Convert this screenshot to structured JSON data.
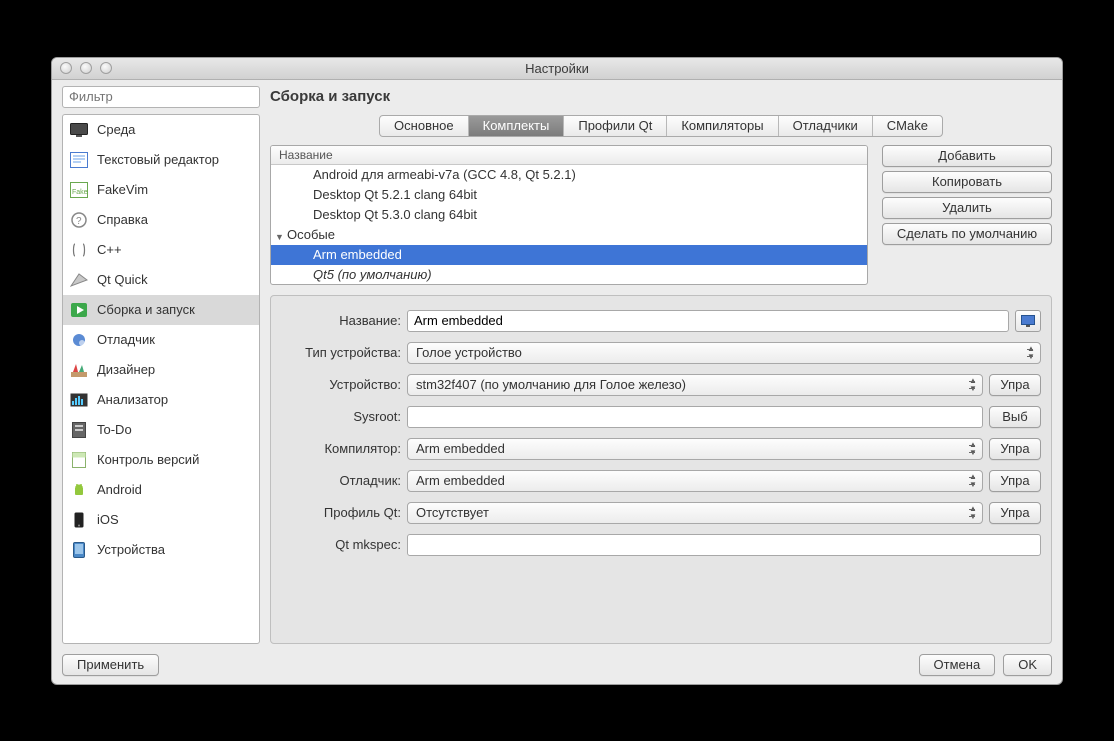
{
  "window": {
    "title": "Настройки"
  },
  "filter": {
    "placeholder": "Фильтр"
  },
  "sidebar": {
    "items": [
      {
        "label": "Среда",
        "icon": "monitor"
      },
      {
        "label": "Текстовый редактор",
        "icon": "text-editor"
      },
      {
        "label": "FakeVim",
        "icon": "fakevim"
      },
      {
        "label": "Справка",
        "icon": "help"
      },
      {
        "label": "C++",
        "icon": "cpp"
      },
      {
        "label": "Qt Quick",
        "icon": "qtquick"
      },
      {
        "label": "Сборка и запуск",
        "icon": "build-run",
        "selected": true
      },
      {
        "label": "Отладчик",
        "icon": "debugger"
      },
      {
        "label": "Дизайнер",
        "icon": "designer"
      },
      {
        "label": "Анализатор",
        "icon": "analyzer"
      },
      {
        "label": "To-Do",
        "icon": "todo"
      },
      {
        "label": "Контроль версий",
        "icon": "vcs"
      },
      {
        "label": "Android",
        "icon": "android"
      },
      {
        "label": "iOS",
        "icon": "ios"
      },
      {
        "label": "Устройства",
        "icon": "devices"
      }
    ]
  },
  "page": {
    "heading": "Сборка и запуск"
  },
  "tabs": [
    {
      "label": "Основное"
    },
    {
      "label": "Комплекты",
      "active": true
    },
    {
      "label": "Профили Qt"
    },
    {
      "label": "Компиляторы"
    },
    {
      "label": "Отладчики"
    },
    {
      "label": "CMake"
    }
  ],
  "kits": {
    "header": "Название",
    "rows": [
      {
        "label": "Android для armeabi-v7a (GCC 4.8, Qt 5.2.1)"
      },
      {
        "label": "Desktop Qt 5.2.1 clang 64bit"
      },
      {
        "label": "Desktop Qt 5.3.0 clang 64bit"
      }
    ],
    "group": "Особые",
    "group_rows": [
      {
        "label": "Arm embedded",
        "selected": true
      },
      {
        "label": "Qt5 (по умолчанию)",
        "italic": true
      }
    ],
    "buttons": {
      "add": "Добавить",
      "clone": "Копировать",
      "remove": "Удалить",
      "make_default": "Сделать по умолчанию"
    }
  },
  "details": {
    "labels": {
      "name": "Название:",
      "device_type": "Тип устройства:",
      "device": "Устройство:",
      "sysroot": "Sysroot:",
      "compiler": "Компилятор:",
      "debugger": "Отладчик:",
      "qt_profile": "Профиль Qt:",
      "mkspec": "Qt mkspec:"
    },
    "values": {
      "name": "Arm embedded",
      "device_type": "Голое устройство",
      "device": "stm32f407 (по умолчанию для Голое железо)",
      "sysroot": "",
      "compiler": "Arm embedded",
      "debugger": "Arm embedded",
      "qt_profile": "Отсутствует",
      "mkspec": ""
    },
    "trail": {
      "manage": "Упра",
      "choose": "Выб"
    }
  },
  "footer": {
    "apply": "Применить",
    "cancel": "Отмена",
    "ok": "OK"
  }
}
